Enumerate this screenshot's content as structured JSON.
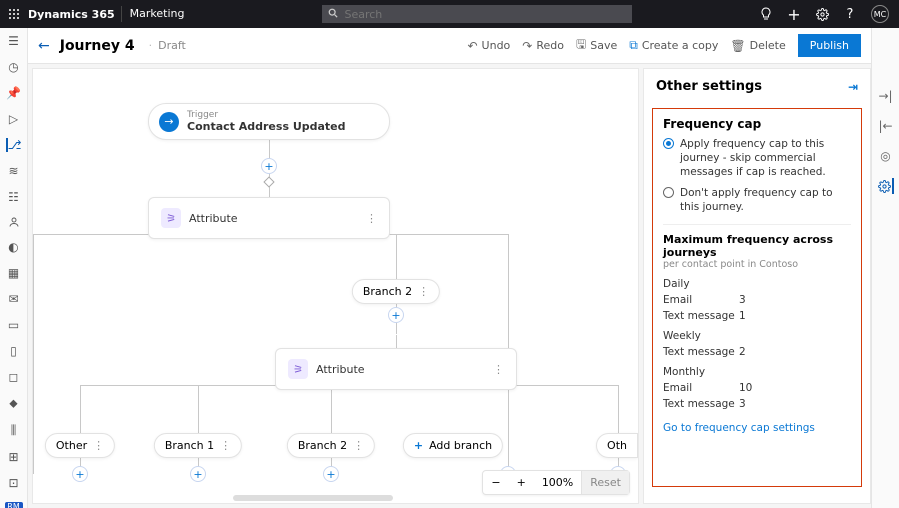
{
  "topbar": {
    "brand": "Dynamics 365",
    "module": "Marketing",
    "search_placeholder": "Search",
    "avatar": "MC"
  },
  "leftrail_badge": "RM",
  "cmdbar": {
    "title": "Journey 4",
    "status": "Draft",
    "undo": "Undo",
    "redo": "Redo",
    "save": "Save",
    "copy": "Create a copy",
    "delete": "Delete",
    "publish": "Publish"
  },
  "canvas": {
    "trigger_caption": "Trigger",
    "trigger_label": "Contact Address Updated",
    "attr1": "Attribute",
    "branch2": "Branch 2",
    "attr2": "Attribute",
    "other_left": "Other",
    "branch1_b": "Branch 1",
    "branch2_b": "Branch 2",
    "add_branch": "Add branch",
    "other_right": "Oth",
    "zoom": {
      "level": "100%",
      "reset": "Reset"
    }
  },
  "panel": {
    "title": "Other settings",
    "section": "Frequency cap",
    "opt_apply": "Apply frequency cap to this journey - skip commercial messages if cap is reached.",
    "opt_noapply": "Don't apply frequency cap to this journey.",
    "max_title": "Maximum frequency across journeys",
    "max_sub": "per contact point in Contoso",
    "periods": {
      "daily": {
        "label": "Daily",
        "rows": [
          {
            "channel": "Email",
            "value": "3"
          },
          {
            "channel": "Text message",
            "value": "1"
          }
        ]
      },
      "weekly": {
        "label": "Weekly",
        "rows": [
          {
            "channel": "Text message",
            "value": "2"
          }
        ]
      },
      "monthly": {
        "label": "Monthly",
        "rows": [
          {
            "channel": "Email",
            "value": "10"
          },
          {
            "channel": "Text message",
            "value": "3"
          }
        ]
      }
    },
    "link": "Go to frequency cap settings"
  }
}
